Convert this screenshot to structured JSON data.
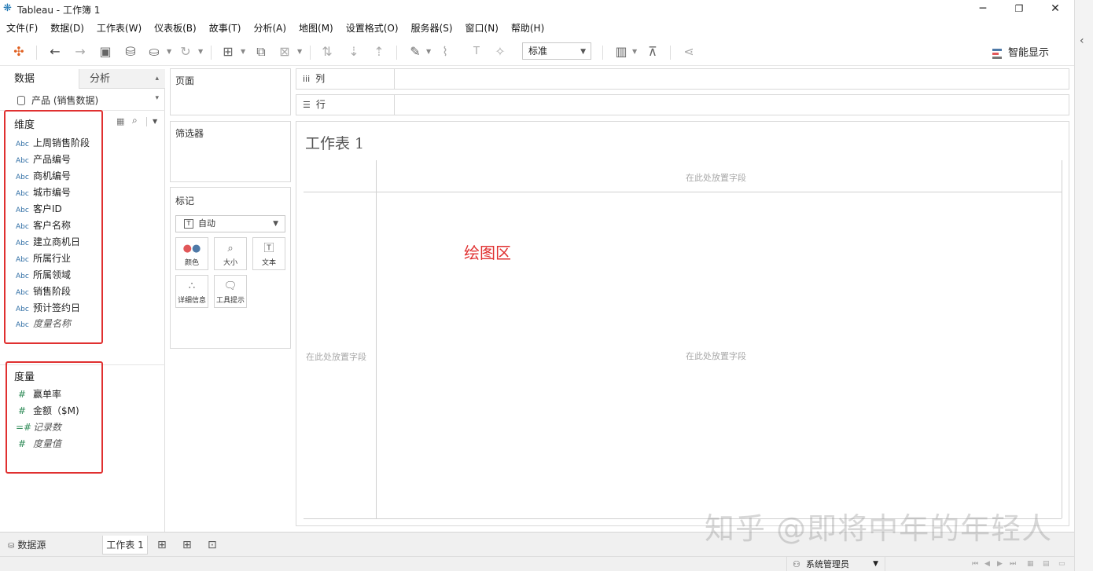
{
  "window": {
    "title": "Tableau - 工作簿 1",
    "minimize": "─",
    "restore": "❐",
    "close": "✕"
  },
  "menu": [
    "文件(F)",
    "数据(D)",
    "工作表(W)",
    "仪表板(B)",
    "故事(T)",
    "分析(A)",
    "地图(M)",
    "设置格式(O)",
    "服务器(S)",
    "窗口(N)",
    "帮助(H)"
  ],
  "toolbar": {
    "fit_select": "标准",
    "show_me_label": "智能显示"
  },
  "data_pane": {
    "tab_data": "数据",
    "tab_analysis": "分析",
    "datasource": "产品 (销售数据)",
    "dimensions_title": "维度",
    "dimensions": [
      {
        "type": "Abc",
        "name": "上周销售阶段"
      },
      {
        "type": "Abc",
        "name": "产品编号"
      },
      {
        "type": "Abc",
        "name": "商机编号"
      },
      {
        "type": "Abc",
        "name": "城市编号"
      },
      {
        "type": "Abc",
        "name": "客户ID"
      },
      {
        "type": "Abc",
        "name": "客户名称"
      },
      {
        "type": "Abc",
        "name": "建立商机日"
      },
      {
        "type": "Abc",
        "name": "所属行业"
      },
      {
        "type": "Abc",
        "name": "所属领域"
      },
      {
        "type": "Abc",
        "name": "销售阶段"
      },
      {
        "type": "Abc",
        "name": "预计签约日"
      },
      {
        "type": "Abc",
        "name": "度量名称"
      }
    ],
    "measures_title": "度量",
    "measures": [
      {
        "type": "#",
        "name": "赢单率"
      },
      {
        "type": "#",
        "name": "金额（$M)"
      },
      {
        "type": "=#",
        "name": "记录数"
      },
      {
        "type": "#",
        "name": "度量值"
      }
    ]
  },
  "cards": {
    "pages": "页面",
    "filters": "筛选器",
    "marks": "标记",
    "mark_type": "自动",
    "mark_buttons": [
      {
        "icon": "color-icon",
        "label": "颜色"
      },
      {
        "icon": "size-icon",
        "label": "大小"
      },
      {
        "icon": "text-icon",
        "label": "文本"
      },
      {
        "icon": "detail-icon",
        "label": "详细信息"
      },
      {
        "icon": "tooltip-icon",
        "label": "工具提示"
      }
    ]
  },
  "shelves": {
    "columns": "列",
    "rows": "行"
  },
  "view": {
    "sheet_title": "工作表 1",
    "drop_top": "在此处放置字段",
    "drop_left": "在此处放置字段",
    "drop_center": "在此处放置字段",
    "annotation": "绘图区"
  },
  "bottom": {
    "datasource_tab": "数据源",
    "sheet_tab": "工作表 1"
  },
  "status": {
    "user": "系统管理员"
  },
  "watermark": "知乎 @即将中年的年轻人",
  "colors": {
    "highlight_red": "#e03030",
    "field_blue": "#2e6da4",
    "measure_green": "#2e8b57"
  }
}
